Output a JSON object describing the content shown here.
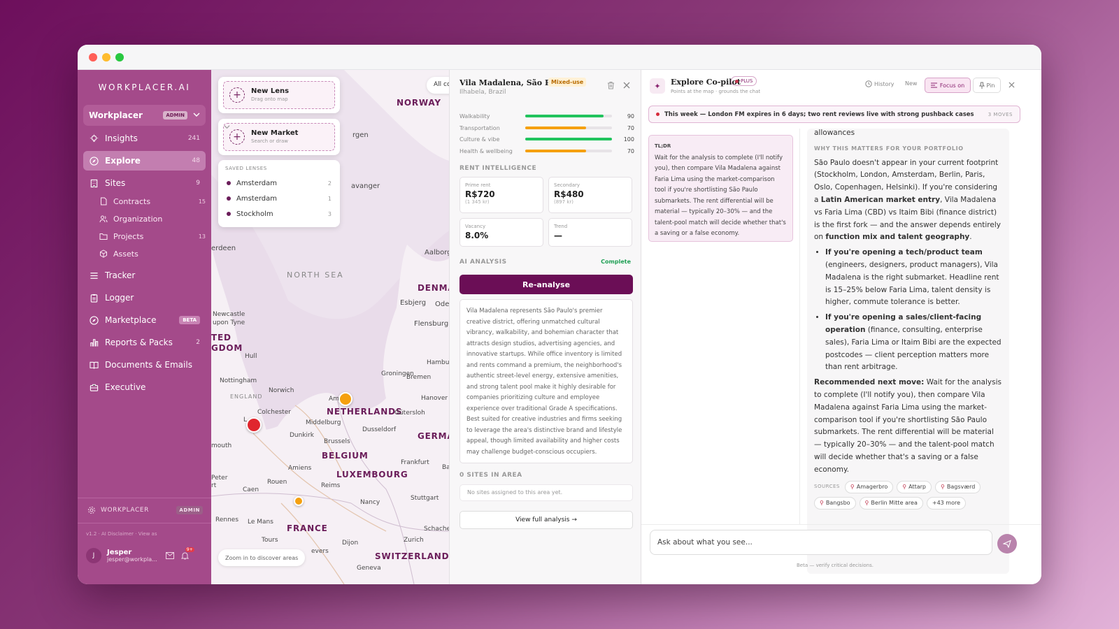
{
  "sidebar": {
    "logo": "WORKPLACER.AI",
    "org": {
      "name": "Workplacer",
      "badge": "ADMIN"
    },
    "nav": [
      {
        "label": "Insights",
        "count": "241"
      },
      {
        "label": "Explore",
        "count": "48"
      },
      {
        "label": "Sites",
        "count": "9"
      }
    ],
    "sub": [
      {
        "label": "Contracts",
        "count": "15"
      },
      {
        "label": "Organization",
        "count": ""
      },
      {
        "label": "Projects",
        "count": "13"
      },
      {
        "label": "Assets",
        "count": ""
      }
    ],
    "nav2": [
      {
        "label": "Tracker",
        "count": ""
      },
      {
        "label": "Logger",
        "count": ""
      },
      {
        "label": "Marketplace",
        "badge": "BETA"
      },
      {
        "label": "Reports & Packs",
        "count": "2"
      },
      {
        "label": "Documents & Emails",
        "count": ""
      },
      {
        "label": "Executive",
        "count": ""
      }
    ],
    "footer": {
      "workspace": "WORKPLACER",
      "badge": "ADMIN",
      "version": "v1.2  ·  AI Disclaimer  ·  View as",
      "user_initial": "J",
      "user_name": "Jesper",
      "user_email": "jesper@workpla..."
    }
  },
  "map": {
    "new_lens": {
      "title": "New Lens",
      "sub": "Drag onto map"
    },
    "new_market": {
      "title": "New Market",
      "sub": "Search or draw"
    },
    "saved_header": "SAVED LENSES",
    "saved": [
      {
        "name": "Amsterdam",
        "count": "2"
      },
      {
        "name": "Amsterdam",
        "count": "1"
      },
      {
        "name": "Stockholm",
        "count": "3"
      }
    ],
    "all_chip": "All cc",
    "zoom_hint": "Zoom in to discover areas",
    "sea": "NORTH SEA",
    "countries": [
      "NORWAY",
      "DENMA",
      "NETHERLANDS",
      "BELGIUM",
      "LUXEMBOURG",
      "FRANCE",
      "GERMA",
      "SWITZERLAND",
      "TED",
      "GDOM"
    ],
    "places": [
      "rgen",
      "avanger",
      "erdeen",
      "Aalborg",
      "Esbjerg",
      "Oden",
      "Flensburg",
      "Newcastle",
      "upon Tyne",
      "Hull",
      "Nottingham",
      "ENGLAND",
      "Norwich",
      "Colchester",
      "Am  am",
      "Groningen",
      "Hambu",
      "Bremen",
      "Hanover",
      "Gütersloh",
      "Middelburg",
      "Dunkirk",
      "Brussels",
      "Dusseldorf",
      "mouth",
      "Peter",
      "Caen",
      "Rouen",
      "Amiens",
      "Reims",
      "Frankfurt",
      "Ba",
      "Stuttgart",
      "Nancy",
      "Rennes",
      "Le Mans",
      "Tours",
      "Dijon",
      "Zurich",
      "Schache",
      "evers",
      "Geneva",
      "rt",
      "L"
    ],
    "pin_colors": {
      "red": "#e0262e",
      "orange": "#f5a00f"
    }
  },
  "detail": {
    "title": "Vila Madalena, São Paulo",
    "tag": "Mixed-use",
    "subtitle": "Ilhabela, Brazil",
    "metrics": [
      {
        "label": "Walkability",
        "value": 90,
        "color": "#21c45d"
      },
      {
        "label": "Transportation",
        "value": 70,
        "color": "#f5a00f"
      },
      {
        "label": "Culture & vibe",
        "value": 100,
        "color": "#21c45d"
      },
      {
        "label": "Health & wellbeing",
        "value": 70,
        "color": "#f5a00f"
      }
    ],
    "rent_header": "RENT INTELLIGENCE",
    "rent": [
      {
        "label": "Prime rent",
        "value": "R$720",
        "sub": "(1 345 kr)"
      },
      {
        "label": "Secondary",
        "value": "R$480",
        "sub": "(897 kr)"
      },
      {
        "label": "Vacancy",
        "value": "8.0%",
        "sub": ""
      },
      {
        "label": "Trend",
        "value": "—",
        "sub": ""
      }
    ],
    "ai_header": "AI ANALYSIS",
    "ai_status": "Complete",
    "reanalyse": "Re-analyse",
    "analysis": "Vila Madalena represents São Paulo's premier creative district, offering unmatched cultural vibrancy, walkability, and bohemian character that attracts design studios, advertising agencies, and innovative startups. While office inventory is limited and rents command a premium, the neighborhood's authentic street-level energy, extensive amenities, and strong talent pool make it highly desirable for companies prioritizing culture and employee experience over traditional Grade A specifications. Best suited for creative industries and firms seeking to leverage the area's distinctive brand and lifestyle appeal, though limited availability and higher costs may challenge budget-conscious occupiers.",
    "sites_header": "0 SITES IN AREA",
    "no_sites": "No sites assigned to this area yet.",
    "view_full": "View full analysis →"
  },
  "copilot": {
    "title": "Explore Co-pilot",
    "badge": "PLUS",
    "subtitle": "Points at the map · grounds the chat",
    "history": "History",
    "new": "New",
    "focus": "Focus on",
    "pin": "Pin",
    "alert": "This week — London FM expires in 6 days; two rent reviews live with strong pushback cases",
    "alert_moves": "3 MOVES",
    "tldr_header": "TL;DR",
    "tldr": "Wait for the analysis to complete (I'll notify you), then compare Vila Madalena against Faria Lima using the market-comparison tool if you're shortlisting São Paulo submarkets. The rent differential will be material — typically 20–30% — and the talent-pool match will decide whether that's a saving or a false economy.",
    "answer": {
      "top": "allowances",
      "why_header": "WHY THIS MATTERS FOR YOUR PORTFOLIO",
      "p1a": "São Paulo doesn't appear in your current footprint (Stockholm, London, Amsterdam, Berlin, Paris, Oslo, Copenhagen, Helsinki). If you're considering a ",
      "p1b": "Latin American market entry",
      "p1c": ", Vila Madalena vs Faria Lima (CBD) vs Itaim Bibi (finance district) is the first fork — and the answer depends entirely on ",
      "p1d": "function mix and talent geography",
      "p1e": ".",
      "b1a": "If you're opening a tech/product team",
      "b1b": " (engineers, designers, product managers), Vila Madalena is the right submarket. Headline rent is 15–25% below Faria Lima, talent density is higher, commute tolerance is better.",
      "b2a": "If you're opening a sales/client-facing operation",
      "b2b": " (finance, consulting, enterprise sales), Faria Lima or Itaim Bibi are the expected postcodes — client perception matters more than rent arbitrage.",
      "recA": "Recommended next move:",
      "recB": " Wait for the analysis to complete (I'll notify you), then compare Vila Madalena against Faria Lima using the market-comparison tool if you're shortlisting São Paulo submarkets. The rent differential will be material — typically 20–30% — and the talent-pool match will decide whether that's a saving or a false economy.",
      "sources_label": "SOURCES",
      "sources": [
        "Amagerbro",
        "Attarp",
        "Bagsværd",
        "Bangsbo",
        "Berlin Mitte area"
      ],
      "more": "+43 more"
    },
    "input_placeholder": "Ask about what you see...",
    "beta_note": "Beta — verify critical decisions."
  }
}
